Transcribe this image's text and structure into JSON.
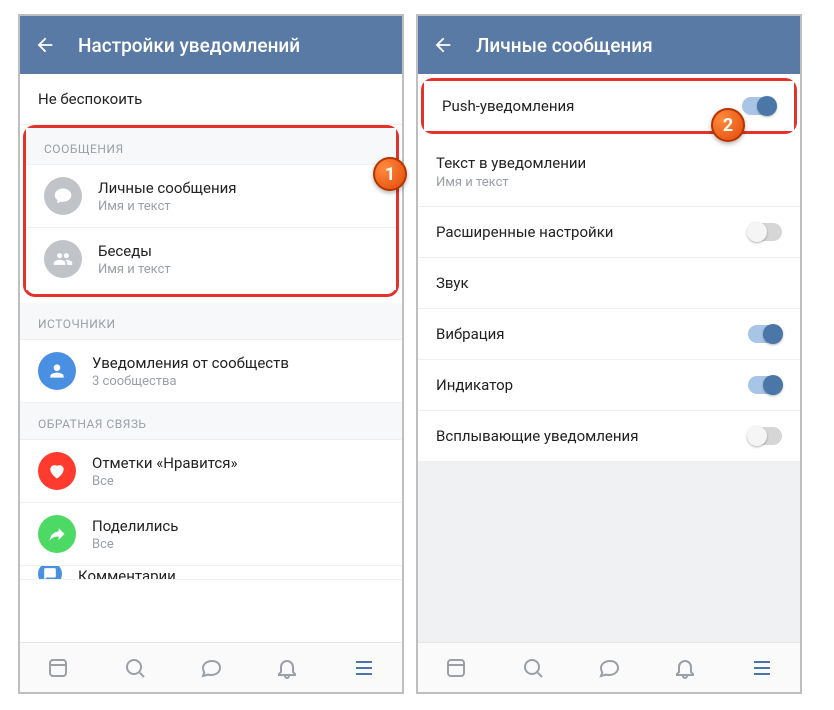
{
  "left": {
    "title": "Настройки уведомлений",
    "doNotDisturb": "Не беспокоить",
    "section_messages": "СООБЩЕНИЯ",
    "personal": {
      "title": "Личные сообщения",
      "sub": "Имя и текст"
    },
    "chats": {
      "title": "Беседы",
      "sub": "Имя и текст"
    },
    "section_sources": "ИСТОЧНИКИ",
    "communities": {
      "title": "Уведомления от сообществ",
      "sub": "3 сообщества"
    },
    "section_feedback": "ОБРАТНАЯ СВЯЗЬ",
    "likes": {
      "title": "Отметки «Нравится»",
      "sub": "Все"
    },
    "shares": {
      "title": "Поделились",
      "sub": "Все"
    },
    "comments": {
      "title": "Комментарии"
    }
  },
  "right": {
    "title": "Личные сообщения",
    "push": {
      "label": "Push-уведомления",
      "on": true
    },
    "textInNotif": {
      "title": "Текст в уведомлении",
      "sub": "Имя и текст"
    },
    "advanced": {
      "label": "Расширенные настройки",
      "on": false
    },
    "sound": {
      "label": "Звук"
    },
    "vibration": {
      "label": "Вибрация",
      "on": true
    },
    "indicator": {
      "label": "Индикатор",
      "on": true
    },
    "popup": {
      "label": "Всплывающие уведомления",
      "on": false
    }
  },
  "markers": {
    "one": "1",
    "two": "2"
  }
}
